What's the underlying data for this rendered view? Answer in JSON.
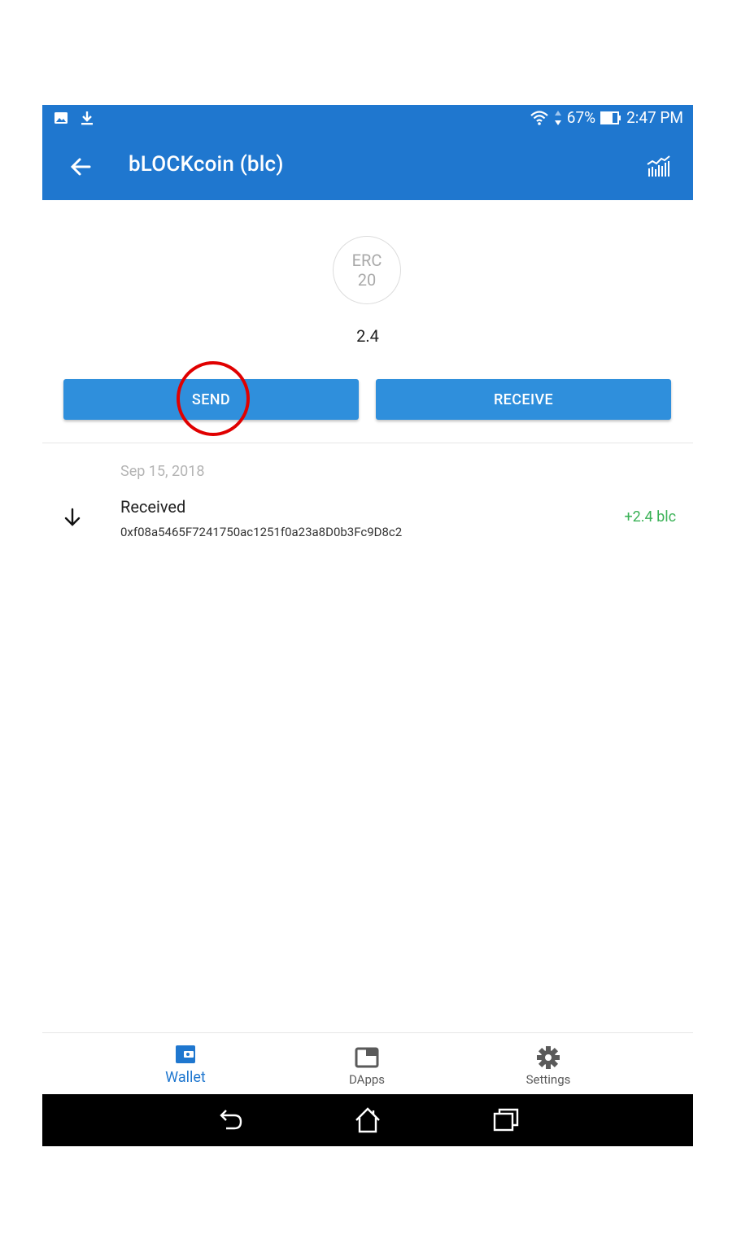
{
  "status_bar": {
    "battery": "67%",
    "time": "2:47 PM",
    "icons": [
      "image-icon",
      "download-icon",
      "wifi-icon",
      "battery-icon"
    ]
  },
  "app_bar": {
    "title": "bLOCKcoin (blc)",
    "icons": [
      "back-arrow-icon",
      "price-chart-icon"
    ]
  },
  "token": {
    "logo_line1": "ERC",
    "logo_line2": "20",
    "balance": "2.4"
  },
  "actions": {
    "send_label": "SEND",
    "receive_label": "RECEIVE"
  },
  "transactions": {
    "date": "Sep 15, 2018",
    "items": [
      {
        "type": "Received",
        "address": "0xf08a5465F7241750ac1251f0a23a8D0b3Fc9D8c2",
        "amount": "+2.4 blc",
        "icon": "arrow-down-icon"
      }
    ]
  },
  "bottom_nav": {
    "items": [
      {
        "label": "Wallet",
        "icon": "wallet-icon",
        "active": true
      },
      {
        "label": "DApps",
        "icon": "dapps-icon",
        "active": false
      },
      {
        "label": "Settings",
        "icon": "gear-icon",
        "active": false
      }
    ]
  },
  "colors": {
    "primary": "#1f77cf",
    "button": "#2f8fdc",
    "positive": "#3bb257",
    "highlight": "#e00000"
  }
}
